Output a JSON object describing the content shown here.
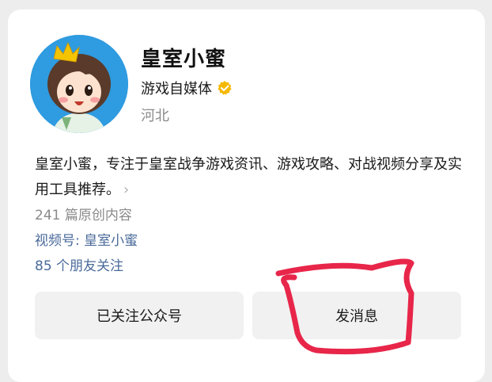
{
  "profile": {
    "name": "皇室小蜜",
    "account_type": "游戏自媒体",
    "region": "河北",
    "description": "皇室小蜜，专注于皇室战争游戏资讯、游戏攻略、对战视频分享及实用工具推荐。",
    "articles_count": "241 篇原创内容",
    "channel": "视频号: 皇室小蜜",
    "friends_following": "85 个朋友关注"
  },
  "buttons": {
    "followed_label": "已关注公众号",
    "message_label": "发消息"
  },
  "icons": {
    "verified": "verified-badge-icon",
    "more": "chevron-right-icon"
  },
  "colors": {
    "link": "#4a6a9a",
    "verified": "#f5b800",
    "annotation": "#e8264a",
    "avatar_bg": "#2f9be0"
  }
}
